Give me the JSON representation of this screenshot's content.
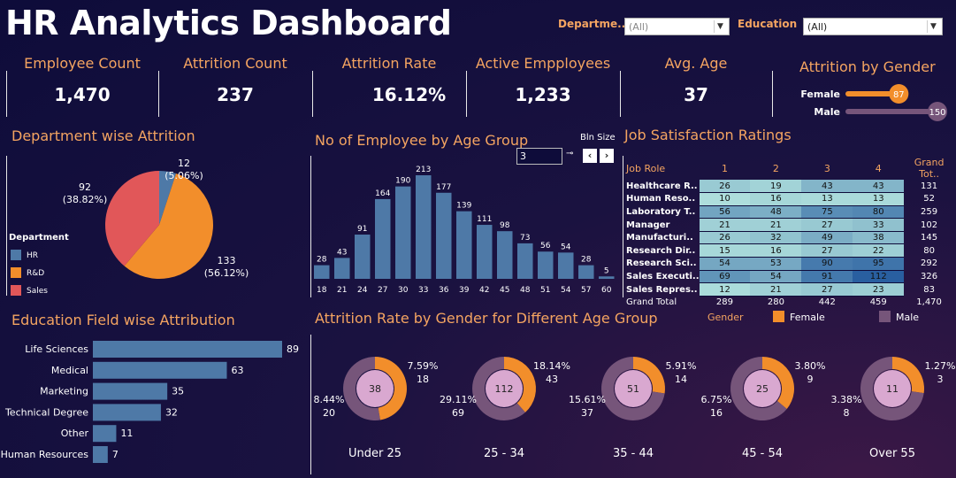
{
  "title": "HR Analytics Dashboard",
  "filters": {
    "department_label": "Departme..",
    "department_value": "(All)",
    "education_label": "Education",
    "education_value": "(All)"
  },
  "kpis": [
    {
      "label": "Employee Count",
      "value": "1,470"
    },
    {
      "label": "Attrition Count",
      "value": "237"
    },
    {
      "label": "Attrition Rate",
      "value": "16.12%"
    },
    {
      "label": "Active Empployees",
      "value": "1,233"
    },
    {
      "label": "Avg. Age",
      "value": "37"
    }
  ],
  "colors": {
    "accent": "#f4a461",
    "hr": "#4e79a7",
    "rnd": "#f28e2b",
    "sales": "#e15759",
    "bar": "#4e79a7",
    "female": "#f28e2b",
    "male": "#76557a",
    "donut_center": "#d9a8d0"
  },
  "chart_data": [
    {
      "id": "attrition_by_gender",
      "type": "bar",
      "title": "Attrition by Gender",
      "categories": [
        "Female",
        "Male"
      ],
      "values": [
        87,
        150
      ],
      "xlim": [
        0,
        150
      ]
    },
    {
      "id": "department_attrition",
      "type": "pie",
      "title": "Department wise Attrition",
      "legend_title": "Department",
      "legend_placement": "left",
      "slices": [
        {
          "label": "HR",
          "value": 12,
          "pct": "5.06%"
        },
        {
          "label": "R&D",
          "value": 133,
          "pct": "56.12%"
        },
        {
          "label": "Sales",
          "value": 92,
          "pct": "38.82%"
        }
      ]
    },
    {
      "id": "age_group",
      "type": "bar",
      "title": "No of Employee by Age Group",
      "bin_size_label": "Bln Size",
      "bin_size_value": "3",
      "categories": [
        "18",
        "21",
        "24",
        "27",
        "30",
        "33",
        "36",
        "39",
        "42",
        "45",
        "48",
        "51",
        "54",
        "57",
        "60"
      ],
      "values": [
        28,
        43,
        91,
        164,
        190,
        213,
        177,
        139,
        111,
        98,
        73,
        56,
        54,
        28,
        5
      ],
      "ylim": [
        0,
        213
      ]
    },
    {
      "id": "job_satisfaction",
      "type": "heatmap",
      "title": "Job Satisfaction Ratings",
      "row_header": "Job Role",
      "columns": [
        "1",
        "2",
        "3",
        "4"
      ],
      "total_header": "Grand Tot..",
      "rows": [
        {
          "role": "Healthcare R..",
          "values": [
            26,
            19,
            43,
            43
          ],
          "total": 131
        },
        {
          "role": "Human Reso..",
          "values": [
            10,
            16,
            13,
            13
          ],
          "total": 52
        },
        {
          "role": "Laboratory T..",
          "values": [
            56,
            48,
            75,
            80
          ],
          "total": 259
        },
        {
          "role": "Manager",
          "values": [
            21,
            21,
            27,
            33
          ],
          "total": 102
        },
        {
          "role": "Manufacturi..",
          "values": [
            26,
            32,
            49,
            38
          ],
          "total": 145
        },
        {
          "role": "Research Dir..",
          "values": [
            15,
            16,
            27,
            22
          ],
          "total": 80
        },
        {
          "role": "Research Sci..",
          "values": [
            54,
            53,
            90,
            95
          ],
          "total": 292
        },
        {
          "role": "Sales Executi..",
          "values": [
            69,
            54,
            91,
            112
          ],
          "total": 326
        },
        {
          "role": "Sales Repres..",
          "values": [
            12,
            21,
            27,
            23
          ],
          "total": 83
        }
      ],
      "grand_total_label": "Grand Total",
      "grand_totals": [
        289,
        280,
        442,
        459
      ],
      "grand_total_all": "1,470"
    },
    {
      "id": "education_field",
      "type": "bar",
      "title": "Education Field wise Attribution",
      "categories": [
        "Life Sciences",
        "Medical",
        "Marketing",
        "Technical Degree",
        "Other",
        "Human Resources"
      ],
      "values": [
        89,
        63,
        35,
        32,
        11,
        7
      ],
      "xlim": [
        0,
        89
      ]
    },
    {
      "id": "gender_age_attrition",
      "type": "pie",
      "title": "Attrition Rate by Gender for Different Age Group",
      "legend_title": "Gender",
      "legend": [
        "Female",
        "Male"
      ],
      "groups": [
        {
          "label": "Under 25",
          "total": 38,
          "female": 18,
          "female_pct": "7.59%",
          "male": 20,
          "male_pct": "8.44%"
        },
        {
          "label": "25 - 34",
          "total": 112,
          "female": 43,
          "female_pct": "18.14%",
          "male": 69,
          "male_pct": "29.11%"
        },
        {
          "label": "35 - 44",
          "total": 51,
          "female": 14,
          "female_pct": "5.91%",
          "male": 37,
          "male_pct": "15.61%"
        },
        {
          "label": "45 - 54",
          "total": 25,
          "female": 9,
          "female_pct": "3.80%",
          "male": 16,
          "male_pct": "6.75%"
        },
        {
          "label": "Over 55",
          "total": 11,
          "female": 3,
          "female_pct": "1.27%",
          "male": 8,
          "male_pct": "3.38%"
        }
      ]
    }
  ]
}
